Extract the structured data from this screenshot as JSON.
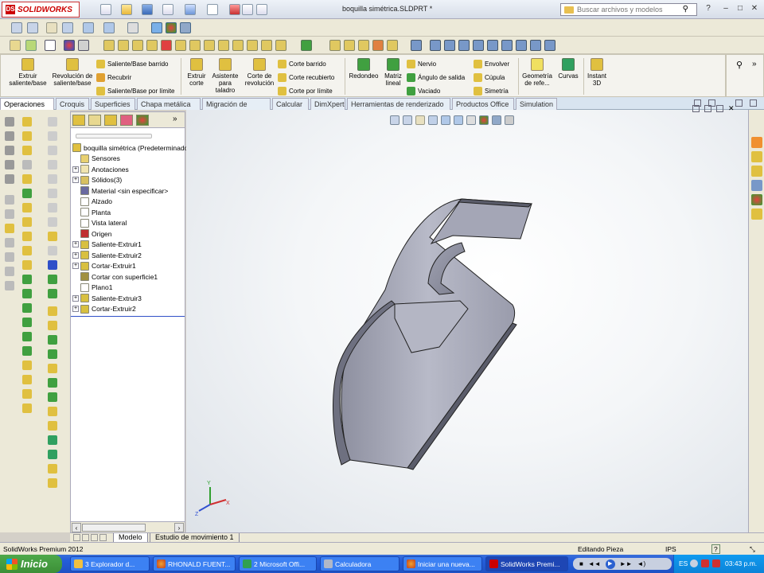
{
  "app": {
    "logo_text": "SOLIDWORKS",
    "doc_title": "boquilla simétrica.SLDPRT *"
  },
  "search": {
    "placeholder": "Buscar archivos y modelos"
  },
  "window_controls": {
    "help": "?",
    "minimize": "–",
    "restore": "□",
    "close": "✕"
  },
  "command_manager": {
    "big": [
      {
        "label": "Extruir saliente/base"
      },
      {
        "label": "Revolución de saliente/base"
      },
      {
        "label": "Extruir corte"
      },
      {
        "label": "Asistente para taladro"
      },
      {
        "label": "Corte de revolución"
      },
      {
        "label": "Redondeo"
      },
      {
        "label": "Matriz lineal"
      },
      {
        "label": "Geometría de refe..."
      },
      {
        "label": "Curvas"
      },
      {
        "label": "Instant 3D"
      }
    ],
    "small": [
      {
        "label": "Saliente/Base barrido"
      },
      {
        "label": "Recubrir"
      },
      {
        "label": "Saliente/Base por límite"
      },
      {
        "label": "Corte barrido"
      },
      {
        "label": "Corte recubierto"
      },
      {
        "label": "Corte por límite"
      },
      {
        "label": "Nervio"
      },
      {
        "label": "Ángulo de salida"
      },
      {
        "label": "Vaciado"
      },
      {
        "label": "Envolver"
      },
      {
        "label": "Cúpula"
      },
      {
        "label": "Simetría"
      }
    ]
  },
  "tabs": [
    "Operaciones",
    "Croquis",
    "Superficies",
    "Chapa metálica",
    "Migración de datos",
    "Calcular",
    "DimXpert",
    "Herramientas de renderizado",
    "Productos Office",
    "Simulation"
  ],
  "tree": {
    "root": "boquilla simétrica  (Predeterminado",
    "items": [
      {
        "label": "Sensores",
        "exp": false,
        "color": "#e8d070"
      },
      {
        "label": "Anotaciones",
        "exp": true,
        "color": "#f0e4b0"
      },
      {
        "label": "Sólidos(3)",
        "exp": true,
        "color": "#d8c060"
      },
      {
        "label": "Material <sin especificar>",
        "exp": false,
        "color": "#6a6aa0"
      },
      {
        "label": "Alzado",
        "exp": false,
        "color": "#ffffff"
      },
      {
        "label": "Planta",
        "exp": false,
        "color": "#ffffff"
      },
      {
        "label": "Vista lateral",
        "exp": false,
        "color": "#ffffff"
      },
      {
        "label": "Origen",
        "exp": false,
        "color": "#c03030"
      },
      {
        "label": "Saliente-Extruir1",
        "exp": true,
        "color": "#d8c040"
      },
      {
        "label": "Saliente-Extruir2",
        "exp": true,
        "color": "#d8c040"
      },
      {
        "label": "Cortar-Extruir1",
        "exp": true,
        "color": "#d8c040"
      },
      {
        "label": "Cortar con superficie1",
        "exp": false,
        "color": "#a09040"
      },
      {
        "label": "Plano1",
        "exp": false,
        "color": "#ffffff"
      },
      {
        "label": "Saliente-Extruir3",
        "exp": true,
        "color": "#d8c040"
      },
      {
        "label": "Cortar-Extruir2",
        "exp": true,
        "color": "#d8c040"
      }
    ]
  },
  "model_tabs": [
    "Modelo",
    "Estudio de movimiento 1"
  ],
  "status": {
    "left": "SolidWorks Premium 2012",
    "mode": "Editando Pieza",
    "units": "IPS",
    "help": "?"
  },
  "taskbar": {
    "start": "Inicio",
    "tasks": [
      "3 Explorador d...",
      "RHONALD FUENT...",
      "2 Microsoft Offi...",
      "Calculadora",
      "Iniciar una nueva...",
      "SolidWorks Premi..."
    ],
    "lang": "ES",
    "clock": "03:43 p.m."
  },
  "triad": {
    "x": "X",
    "y": "Y",
    "z": "Z"
  },
  "colors": {
    "accent": "#245edb",
    "model": "#a8aab8",
    "start": "#3c8f37"
  }
}
